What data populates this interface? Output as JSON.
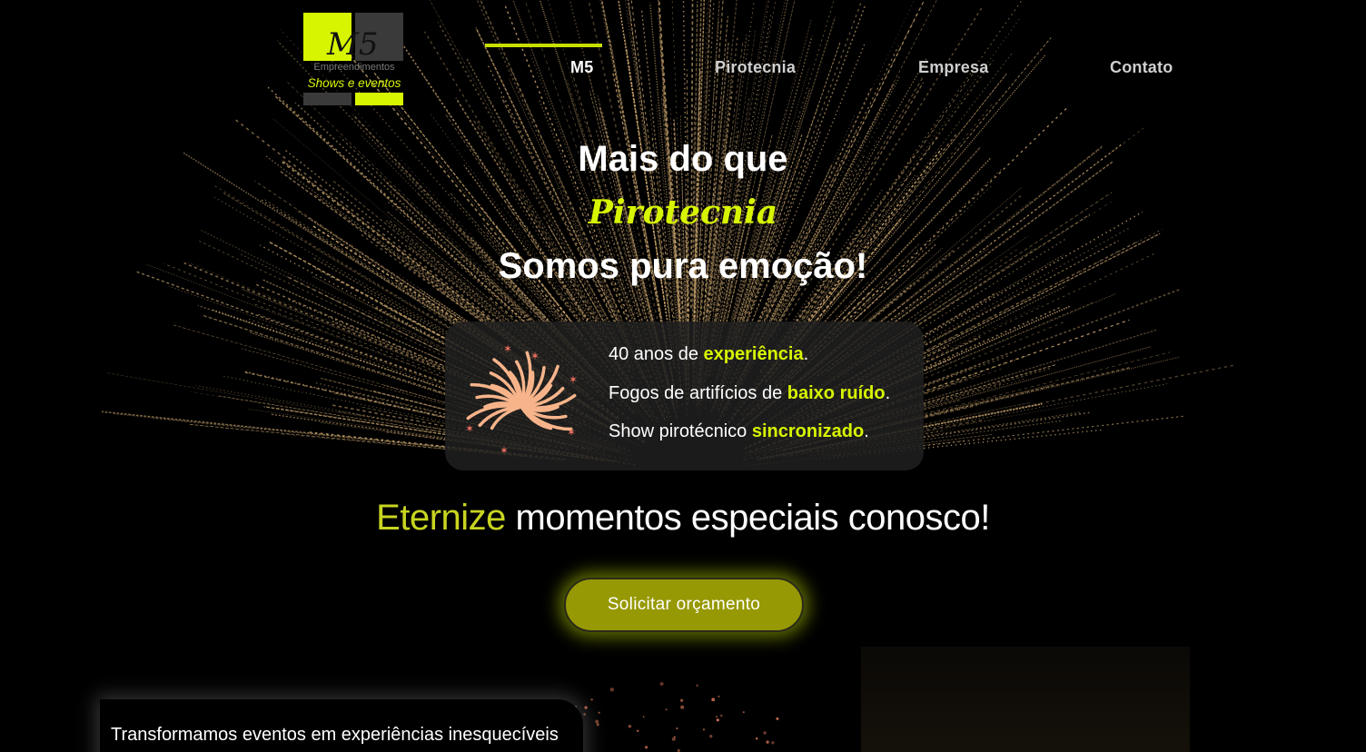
{
  "logo": {
    "mark": "M5",
    "line1": "Empreendimentos",
    "line2": "Shows e eventos",
    "colors": {
      "accent": "#d7f500",
      "dark": "#3a3a3a"
    }
  },
  "nav": {
    "items": [
      {
        "label": "M5",
        "active": true
      },
      {
        "label": "Pirotecnia",
        "active": false
      },
      {
        "label": "Empresa",
        "active": false
      },
      {
        "label": "Contato",
        "active": false
      }
    ]
  },
  "hero": {
    "line1": "Mais do que",
    "accent": "Pirotecnia",
    "line3": "Somos pura emoção!"
  },
  "features": {
    "icon": "firework-icon",
    "items": [
      {
        "prefix": "40 anos de ",
        "highlight": "experiência",
        "suffix": "."
      },
      {
        "prefix": "Fogos de artifícios de ",
        "highlight": "baixo ruído",
        "suffix": "."
      },
      {
        "prefix": "Show pirotécnico ",
        "highlight": "sincronizado",
        "suffix": "."
      }
    ]
  },
  "tagline": {
    "highlight": "Eternize",
    "rest": " momentos especiais conosco!"
  },
  "cta": {
    "label": "Solicitar orçamento"
  },
  "about": {
    "text": "Transformamos eventos em experiências inesquecíveis"
  },
  "colors": {
    "accent": "#d7f500",
    "cta_bg": "#979904",
    "background": "#000000"
  }
}
